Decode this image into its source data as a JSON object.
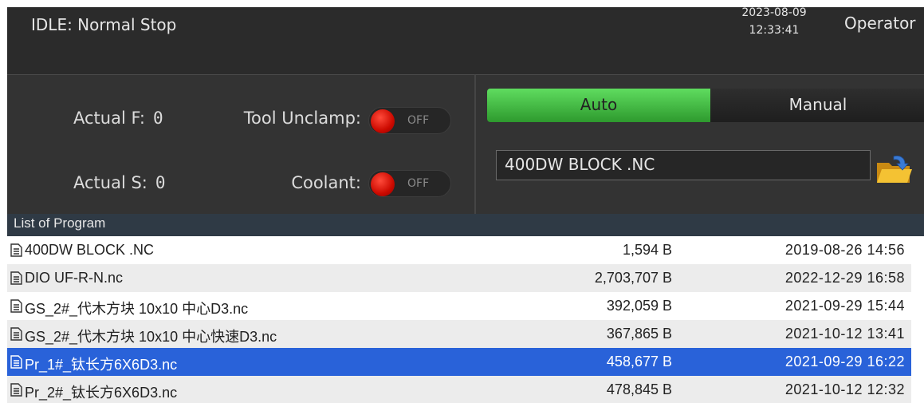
{
  "status": {
    "text": "IDLE: Normal Stop",
    "date": "2023-08-09",
    "time": "12:33:41",
    "user": "Operator"
  },
  "readouts": {
    "feed_label": "Actual F:",
    "feed_value": "0",
    "spindle_label": "Actual S:",
    "spindle_value": "0"
  },
  "toggles": {
    "tool_unclamp_label": "Tool Unclamp:",
    "tool_unclamp_state": "OFF",
    "coolant_label": "Coolant:",
    "coolant_state": "OFF"
  },
  "mode": {
    "auto_label": "Auto",
    "manual_label": "Manual",
    "active": "Auto"
  },
  "program": {
    "current_file": "400DW BLOCK .NC"
  },
  "list": {
    "header": "List of Program",
    "selected_index": 4,
    "rows": [
      {
        "name": "400DW BLOCK .NC",
        "size": "1,594 B",
        "date": "2019-08-26  14:56"
      },
      {
        "name": "DIO UF-R-N.nc",
        "size": "2,703,707 B",
        "date": "2022-12-29  16:58"
      },
      {
        "name": "GS_2#_代木方块 10x10 中心D3.nc",
        "size": "392,059 B",
        "date": "2021-09-29  15:44"
      },
      {
        "name": "GS_2#_代木方块 10x10 中心快速D3.nc",
        "size": "367,865 B",
        "date": "2021-10-12  13:41"
      },
      {
        "name": "Pr_1#_钛长方6X6D3.nc",
        "size": "458,677 B",
        "date": "2021-09-29  16:22"
      },
      {
        "name": "Pr_2#_钛长方6X6D3.nc",
        "size": "478,845 B",
        "date": "2021-10-12  12:32"
      }
    ]
  },
  "colors": {
    "auto_active": "#3fbf3f",
    "selection": "#2962d9",
    "toggle_knob": "#e01a0a"
  }
}
